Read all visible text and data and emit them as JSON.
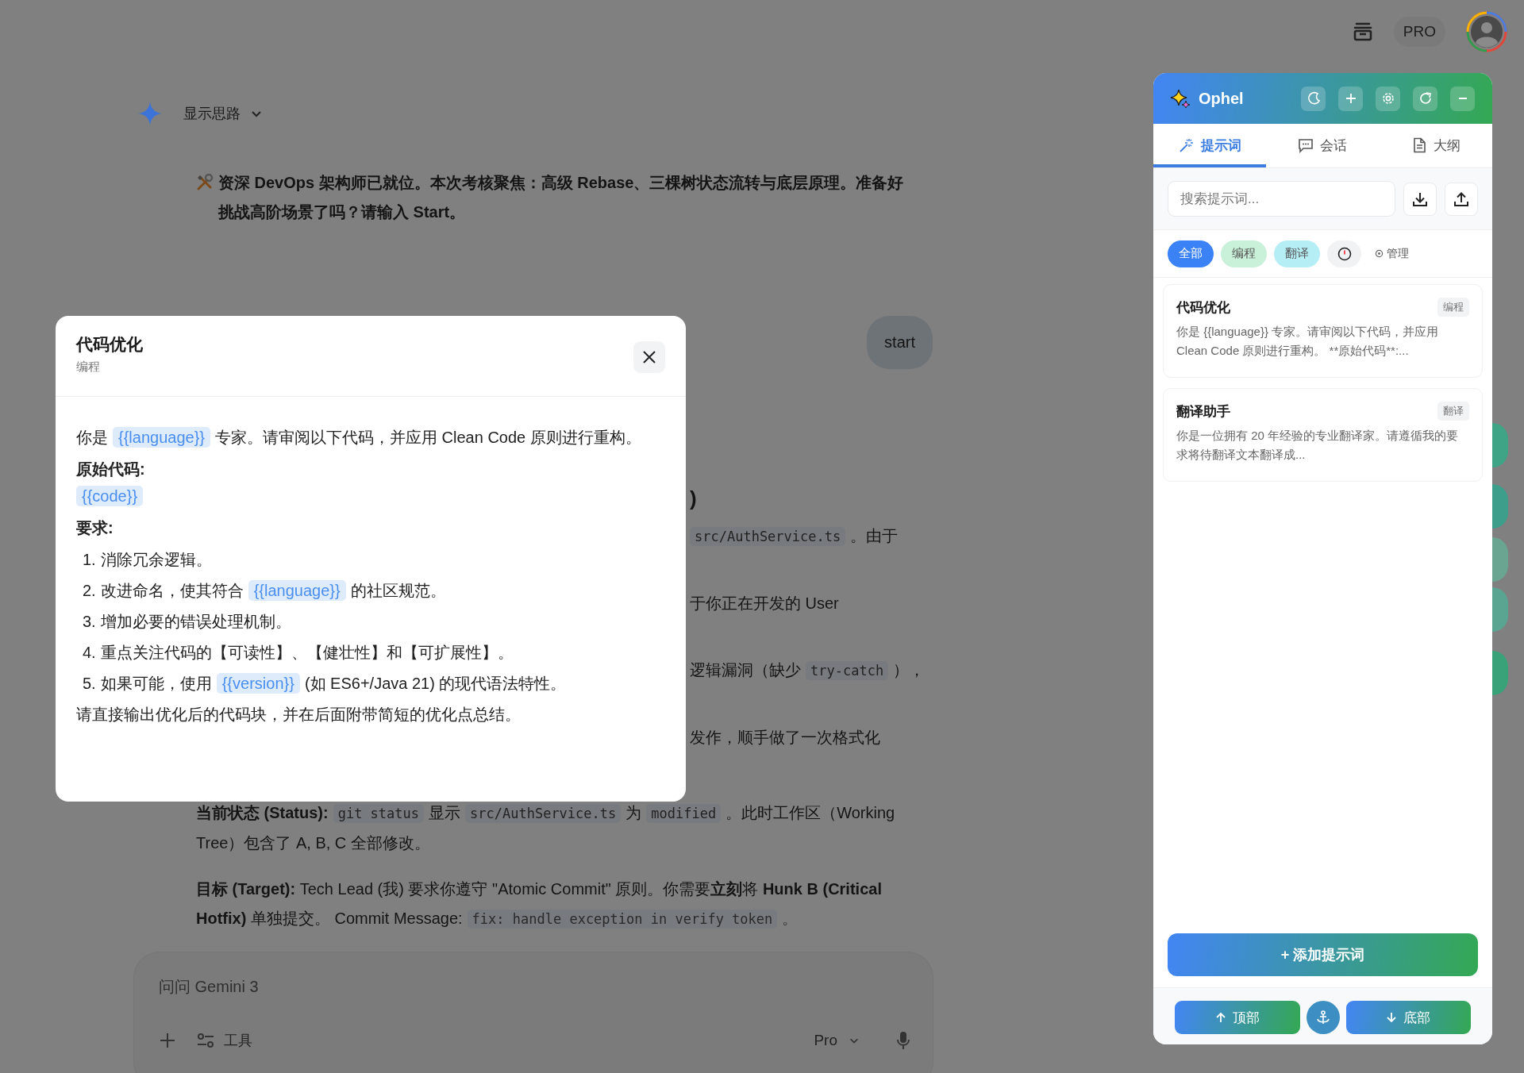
{
  "top_bar": {
    "plan_badge": "PRO"
  },
  "thinking": {
    "label": "显示思路",
    "expanded": false
  },
  "chat": {
    "intro": "资深 DevOps 架构师已就位。本次考核聚焦：高级 Rebase、三棵树状态流转与底层原理。准备好挑战高阶场景了吗？请输入 Start。",
    "user_message": "start",
    "partial_lines": [
      {
        "kind": "heading",
        "segments": [
          {
            "kind": "text",
            "text": ")"
          }
        ]
      },
      {
        "kind": "text",
        "segments": [
          {
            "kind": "code",
            "text": "src/AuthService.ts"
          },
          {
            "kind": "text",
            "text": "。由于"
          }
        ]
      },
      {
        "kind": "text",
        "segments": [
          {
            "kind": "text",
            "text": "于你正在开发的 User"
          }
        ]
      },
      {
        "kind": "text",
        "segments": [
          {
            "kind": "text",
            "text": "逻辑漏洞（缺少"
          },
          {
            "kind": "code",
            "text": "try-catch"
          },
          {
            "kind": "text",
            "text": "），"
          }
        ]
      },
      {
        "kind": "text",
        "segments": [
          {
            "kind": "text",
            "text": "发作，顺手做了一次格式化"
          }
        ]
      }
    ],
    "paragraphs": [
      {
        "segments": [
          {
            "kind": "text",
            "text": "**当前状态 (Status):**"
          },
          {
            "kind": "code",
            "text": "git status"
          },
          {
            "kind": "text",
            "text": "显示"
          },
          {
            "kind": "code",
            "text": "src/AuthService.ts"
          },
          {
            "kind": "text",
            "text": "为"
          },
          {
            "kind": "code",
            "text": "modified"
          },
          {
            "kind": "text",
            "text": "。此时工作区（Working Tree）包含了 A, B, C 全部修改。"
          }
        ]
      },
      {
        "segments": [
          {
            "kind": "text",
            "text": "**目标 (Target):** Tech Lead (我) 要求你遵守 \"Atomic Commit\" 原则。你需要**立刻**将 **Hunk B (Critical Hotfix)** 单独提交。 Commit Message:"
          },
          {
            "kind": "code",
            "text": "fix: handle exception in verify token"
          },
          {
            "kind": "text",
            "text": "。"
          }
        ]
      }
    ]
  },
  "input": {
    "placeholder": "问问 Gemini 3",
    "tools_label": "工具",
    "model": "Pro"
  },
  "modal": {
    "title": "代码优化",
    "category": "编程",
    "blocks": [
      {
        "kind": "paragraph",
        "segments": [
          {
            "kind": "text",
            "text": "你是"
          },
          {
            "kind": "variable",
            "text": "{{language}}"
          },
          {
            "kind": "text",
            "text": "专家。请审阅以下代码，并应用 Clean Code 原则进行重构。"
          }
        ]
      },
      {
        "kind": "heading",
        "text": "原始代码:"
      },
      {
        "kind": "paragraph",
        "segments": [
          {
            "kind": "variable",
            "text": "{{code}}"
          }
        ]
      },
      {
        "kind": "heading",
        "text": "要求:"
      },
      {
        "kind": "list",
        "items": [
          {
            "number": "1.",
            "segments": [
              {
                "kind": "text",
                "text": "消除冗余逻辑。"
              }
            ]
          },
          {
            "number": "2.",
            "segments": [
              {
                "kind": "text",
                "text": "改进命名，使其符合"
              },
              {
                "kind": "variable",
                "text": "{{language}}"
              },
              {
                "kind": "text",
                "text": "的社区规范。"
              }
            ]
          },
          {
            "number": "3.",
            "segments": [
              {
                "kind": "text",
                "text": "增加必要的错误处理机制。"
              }
            ]
          },
          {
            "number": "4.",
            "segments": [
              {
                "kind": "text",
                "text": "重点关注代码的【可读性】、【健壮性】和【可扩展性】。"
              }
            ]
          },
          {
            "number": "5.",
            "segments": [
              {
                "kind": "text",
                "text": "如果可能，使用"
              },
              {
                "kind": "variable",
                "text": "{{version}}"
              },
              {
                "kind": "text",
                "text": "(如 ES6+/Java 21) 的现代语法特性。"
              }
            ]
          }
        ]
      },
      {
        "kind": "paragraph",
        "segments": [
          {
            "kind": "text",
            "text": "请直接输出优化后的代码块，并在后面附带简短的优化点总结。"
          }
        ]
      }
    ]
  },
  "panel": {
    "title": "Ophel",
    "tabs": [
      {
        "label": "提示词",
        "selected": true
      },
      {
        "label": "会话",
        "selected": false
      },
      {
        "label": "大纲",
        "selected": false
      }
    ],
    "search": {
      "placeholder": "搜索提示词..."
    },
    "filters": [
      {
        "kind": "category",
        "label": "全部",
        "selected": true
      },
      {
        "kind": "category",
        "label": "编程",
        "selected": false,
        "color": "#c9f1d9"
      },
      {
        "kind": "category",
        "label": "翻译",
        "selected": false,
        "color": "#b6eef6"
      },
      {
        "kind": "recent",
        "selected": false
      },
      {
        "kind": "manage",
        "label": "管理"
      }
    ],
    "prompts": [
      {
        "title": "代码优化",
        "category": "编程",
        "preview": "你是 {{language}} 专家。请审阅以下代码，并应用 Clean Code 原则进行重构。 **原始代码**:..."
      },
      {
        "title": "翻译助手",
        "category": "翻译",
        "preview": "你是一位拥有 20 年经验的专业翻译家。请遵循我的要求将待翻译文本翻译成..."
      }
    ],
    "add_button": "+ 添加提示词",
    "footer": {
      "top_label": "顶部",
      "bottom_label": "底部"
    }
  }
}
